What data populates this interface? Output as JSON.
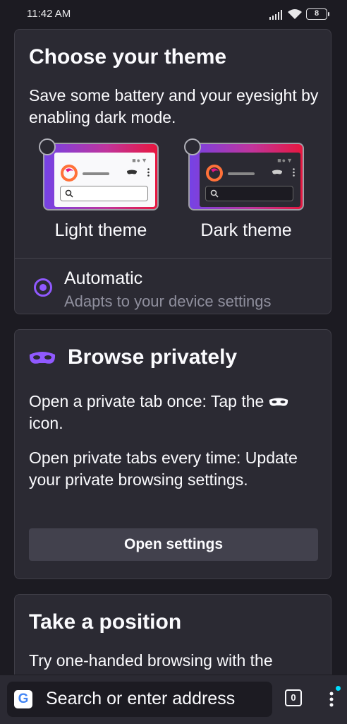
{
  "status_bar": {
    "time": "11:42 AM",
    "battery": "8"
  },
  "theme_card": {
    "title": "Choose your theme",
    "description": "Save some battery and your eyesight by enabling dark mode.",
    "light_label": "Light theme",
    "dark_label": "Dark theme",
    "automatic_title": "Automatic",
    "automatic_subtitle": "Adapts to your device settings"
  },
  "private_card": {
    "title": "Browse privately",
    "text1_before": "Open a private tab once: Tap the",
    "text1_after": "icon.",
    "text2": "Open private tabs every time: Update your private browsing settings.",
    "button": "Open settings"
  },
  "position_card": {
    "title": "Take a position",
    "text": "Try one-handed browsing with the"
  },
  "toolbar": {
    "search_placeholder": "Search or enter address",
    "tab_count": "0",
    "google_letter": "G"
  },
  "colors": {
    "accent": "#9059ff",
    "background": "#1c1b22",
    "card": "#2b2a33"
  },
  "icons": [
    "google-icon",
    "tabs-icon",
    "menu-icon",
    "mask-icon",
    "firefox-logo-icon",
    "search-icon"
  ]
}
